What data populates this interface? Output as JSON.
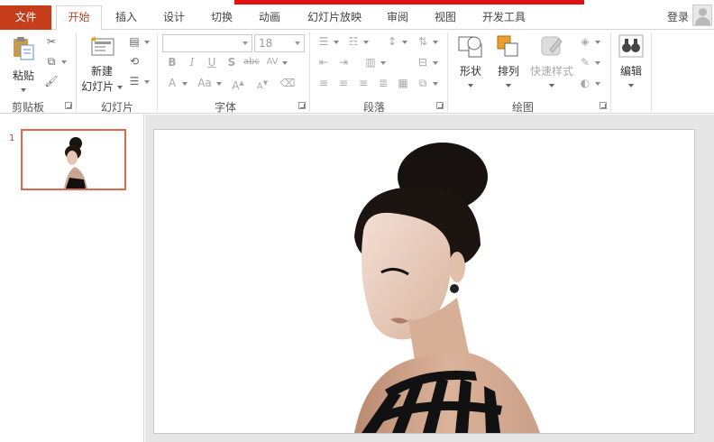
{
  "tabs": [
    {
      "label": "文件"
    },
    {
      "label": "开始"
    },
    {
      "label": "插入"
    },
    {
      "label": "设计"
    },
    {
      "label": "切换"
    },
    {
      "label": "动画"
    },
    {
      "label": "幻灯片放映"
    },
    {
      "label": "审阅"
    },
    {
      "label": "视图"
    },
    {
      "label": "开发工具"
    }
  ],
  "login": "登录",
  "ribbon": {
    "clipboard": {
      "label": "剪贴板",
      "paste": "粘贴"
    },
    "slides": {
      "label": "幻灯片",
      "new_slide_line1": "新建",
      "new_slide_line2": "幻灯片"
    },
    "font": {
      "label": "字体",
      "size": "18"
    },
    "paragraph": {
      "label": "段落"
    },
    "drawing": {
      "label": "绘图",
      "shapes": "形状",
      "arrange": "排列",
      "quick_styles": "快速样式"
    },
    "editing": {
      "label": "编辑"
    }
  },
  "slides_panel": {
    "number": "1"
  },
  "colors": {
    "file_tab": "#c63d1b",
    "active_tab_text": "#c43e1c",
    "thumb_border": "#e0674a"
  }
}
